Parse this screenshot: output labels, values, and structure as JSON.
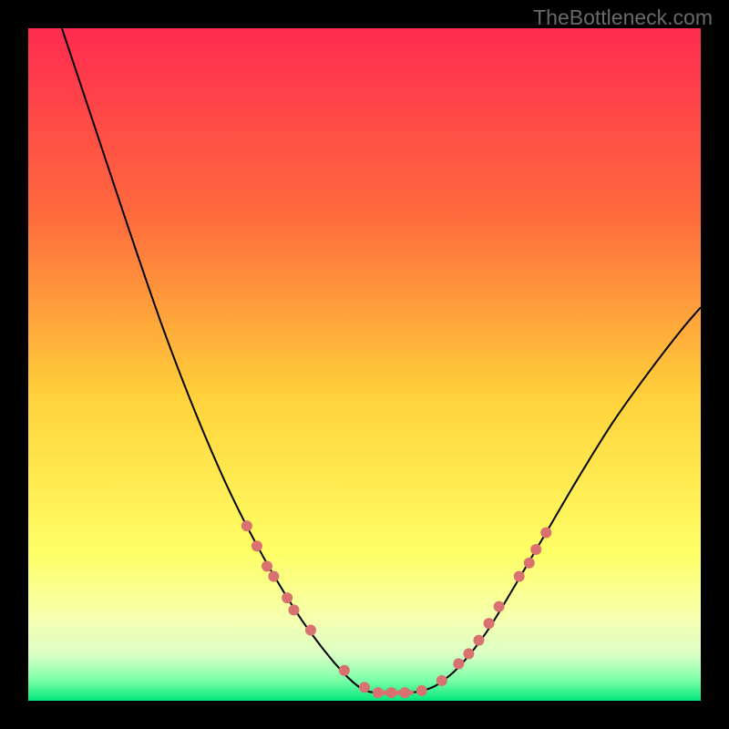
{
  "watermark": "TheBottleneck.com",
  "chart_data": {
    "type": "line",
    "title": "",
    "xlabel": "",
    "ylabel": "",
    "xlim": [
      0,
      100
    ],
    "ylim": [
      0,
      100
    ],
    "background_gradient": {
      "stops": [
        {
          "offset": 0,
          "color": "#ff2b50"
        },
        {
          "offset": 0.28,
          "color": "#ff6b3d"
        },
        {
          "offset": 0.55,
          "color": "#ffd23a"
        },
        {
          "offset": 0.78,
          "color": "#ffff66"
        },
        {
          "offset": 0.88,
          "color": "#f5ffb0"
        },
        {
          "offset": 0.93,
          "color": "#dcffc4"
        },
        {
          "offset": 0.97,
          "color": "#7affa8"
        },
        {
          "offset": 1.0,
          "color": "#00e87a"
        }
      ]
    },
    "series": [
      {
        "name": "left-curve",
        "values": [
          {
            "x": 5.0,
            "y": 100.0
          },
          {
            "x": 10.0,
            "y": 85.0
          },
          {
            "x": 15.0,
            "y": 70.0
          },
          {
            "x": 20.0,
            "y": 55.5
          },
          {
            "x": 25.0,
            "y": 42.5
          },
          {
            "x": 30.0,
            "y": 31.0
          },
          {
            "x": 35.0,
            "y": 21.3
          },
          {
            "x": 40.0,
            "y": 13.0
          },
          {
            "x": 44.0,
            "y": 7.5
          },
          {
            "x": 47.0,
            "y": 4.0
          },
          {
            "x": 49.0,
            "y": 2.2
          },
          {
            "x": 50.5,
            "y": 1.4
          },
          {
            "x": 52.0,
            "y": 1.2
          }
        ]
      },
      {
        "name": "right-curve",
        "values": [
          {
            "x": 57.0,
            "y": 1.2
          },
          {
            "x": 59.0,
            "y": 1.6
          },
          {
            "x": 61.0,
            "y": 2.5
          },
          {
            "x": 64.0,
            "y": 5.0
          },
          {
            "x": 68.0,
            "y": 10.0
          },
          {
            "x": 72.0,
            "y": 16.5
          },
          {
            "x": 77.0,
            "y": 25.0
          },
          {
            "x": 82.0,
            "y": 33.5
          },
          {
            "x": 87.0,
            "y": 41.5
          },
          {
            "x": 92.0,
            "y": 48.5
          },
          {
            "x": 97.0,
            "y": 55.0
          },
          {
            "x": 100.0,
            "y": 58.5
          }
        ]
      }
    ],
    "bottom_band": {
      "y": 1.2,
      "x_start": 52.0,
      "x_end": 57.0,
      "color": "#d8716f",
      "width": 5
    },
    "markers": {
      "color": "#d8716f",
      "radius": 6,
      "points": [
        {
          "x": 32.5,
          "y": 26.0
        },
        {
          "x": 34.0,
          "y": 23.0
        },
        {
          "x": 35.5,
          "y": 20.0
        },
        {
          "x": 36.5,
          "y": 18.5
        },
        {
          "x": 38.5,
          "y": 15.3
        },
        {
          "x": 39.5,
          "y": 13.5
        },
        {
          "x": 42.0,
          "y": 10.5
        },
        {
          "x": 47.0,
          "y": 4.5
        },
        {
          "x": 50.0,
          "y": 2.0
        },
        {
          "x": 52.0,
          "y": 1.2
        },
        {
          "x": 54.0,
          "y": 1.2
        },
        {
          "x": 56.0,
          "y": 1.2
        },
        {
          "x": 58.5,
          "y": 1.5
        },
        {
          "x": 61.5,
          "y": 3.0
        },
        {
          "x": 64.0,
          "y": 5.5
        },
        {
          "x": 65.5,
          "y": 7.0
        },
        {
          "x": 67.0,
          "y": 9.0
        },
        {
          "x": 68.5,
          "y": 11.5
        },
        {
          "x": 70.0,
          "y": 14.0
        },
        {
          "x": 73.0,
          "y": 18.5
        },
        {
          "x": 74.5,
          "y": 20.5
        },
        {
          "x": 75.5,
          "y": 22.5
        },
        {
          "x": 77.0,
          "y": 25.0
        }
      ]
    }
  }
}
